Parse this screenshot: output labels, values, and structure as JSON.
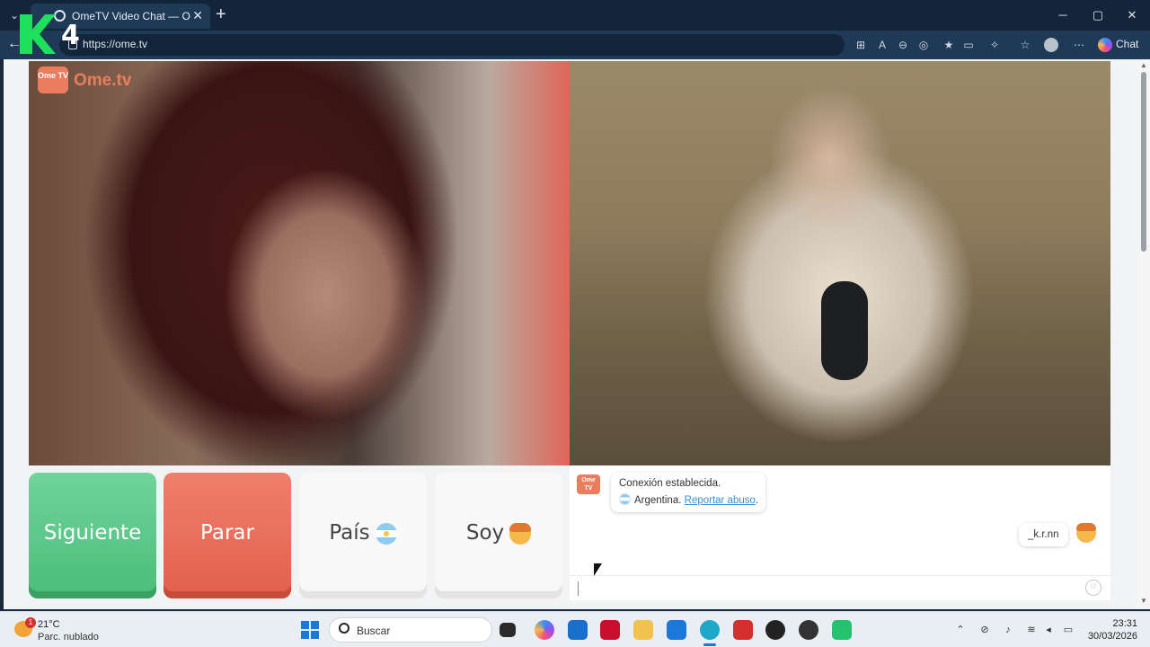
{
  "browser": {
    "tab_title": "OmeTV Video Chat — Omegle",
    "url": "https://ome.tv",
    "copilot_label": "Chat"
  },
  "overlay": {
    "watermark_text": "4"
  },
  "site": {
    "logo_badge": "Ome TV",
    "logo_word": "Ome.tv"
  },
  "controls": {
    "next_label": "Siguiente",
    "stop_label": "Parar",
    "country_label": "País",
    "gender_label": "Soy"
  },
  "chat": {
    "avatar_text": "Ome TV",
    "system_line1": "Conexión establecida.",
    "system_country": "Argentina.",
    "report_link": "Reportar abuso",
    "report_period": ".",
    "user_message": "_k.r.nn",
    "input_value": ""
  },
  "taskbar": {
    "temperature": "21°C",
    "weather_desc": "Parc. nublado",
    "weather_badge": "1",
    "search_placeholder": "Buscar",
    "time": "23:31",
    "date": "30/03/2026"
  },
  "colors": {
    "brand": "#ea7d5d",
    "next_green": "#4bbd7a",
    "stop_red": "#e2604c",
    "link_blue": "#3b8fd0"
  }
}
